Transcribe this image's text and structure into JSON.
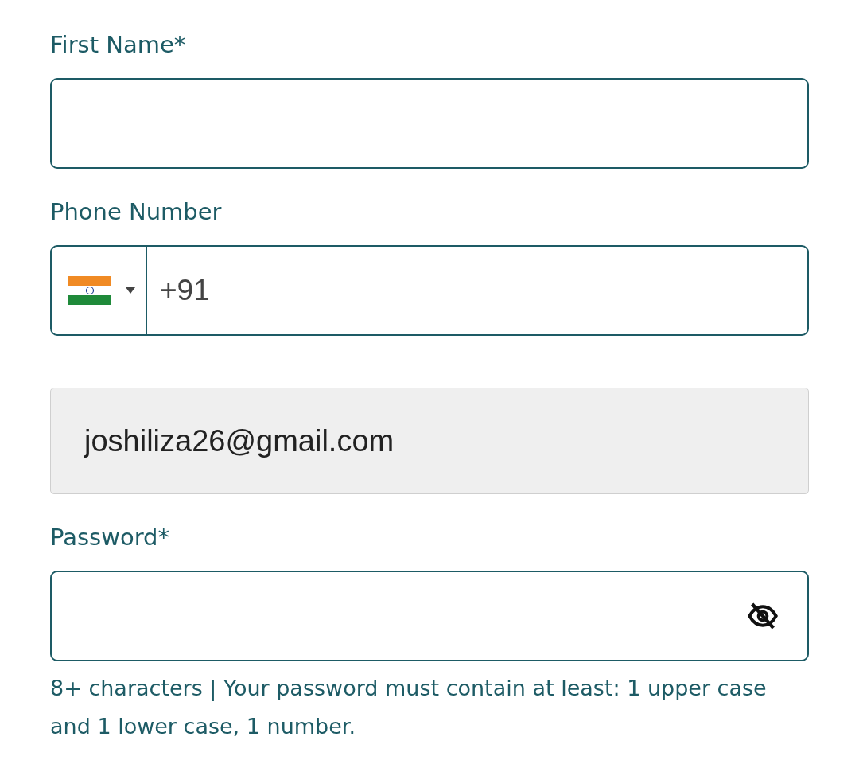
{
  "fields": [
    {
      "kind": "text",
      "label": "First Name*"
    },
    {
      "kind": "phone",
      "label": "Phone Number",
      "value": "+91"
    },
    {
      "kind": "email",
      "value": "joshiliza26@gmail.com",
      "disabled": true
    },
    {
      "kind": "password",
      "label": "Password*",
      "hint": "8+ characters | Your password must contain at least: 1 upper case and 1 lower case, 1 number."
    }
  ]
}
